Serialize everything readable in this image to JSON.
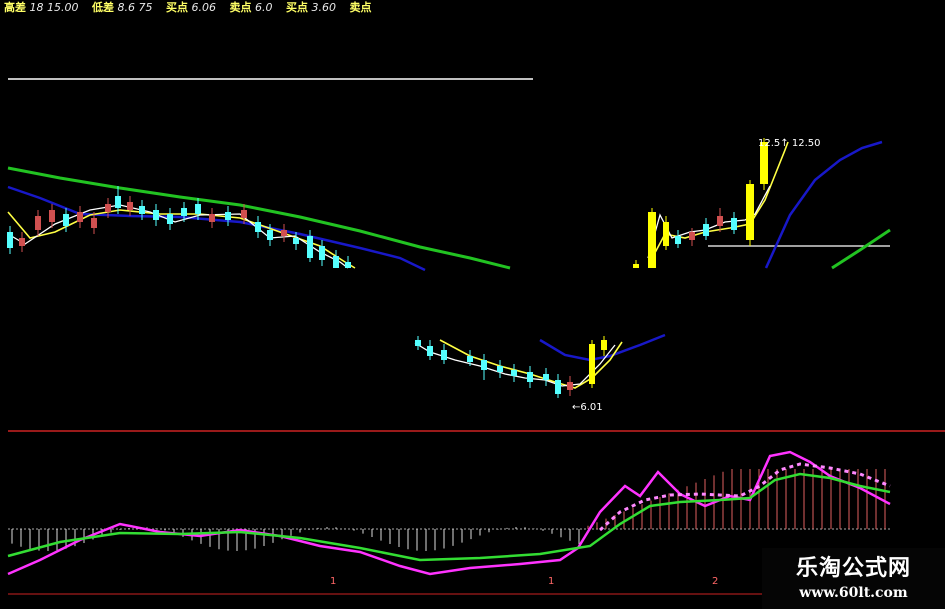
{
  "info_bar": {
    "items": [
      {
        "label": "高差",
        "value": "18 15.00"
      },
      {
        "label": "低差",
        "value": "8.6 75"
      },
      {
        "label": "买点",
        "value": "6.06"
      },
      {
        "label": "卖点",
        "value": "6.0"
      },
      {
        "label": "买点",
        "value": "3.60"
      },
      {
        "label": "卖点",
        "value": ""
      }
    ]
  },
  "price_labels": {
    "high_marker": "12.50",
    "high_marker_prefix": "12.5↑",
    "low_marker": "←6.01"
  },
  "lower_panel_ticks": [
    "1",
    "2",
    "1",
    "2"
  ],
  "watermark": {
    "title": "乐淘公式网",
    "url": "www.60lt.com"
  },
  "colors": {
    "background": "#000000",
    "ma_white": "#ffffff",
    "ma_yellow": "#ffff44",
    "ma_green": "#22c322",
    "ma_blue": "#1818c8",
    "candle_up": "#d05050",
    "candle_down": "#55ffff",
    "yellow_bar": "#ffff00",
    "macd_magenta": "#ff33ff",
    "macd_green": "#33dd33",
    "divider_red": "#cc2222"
  }
}
